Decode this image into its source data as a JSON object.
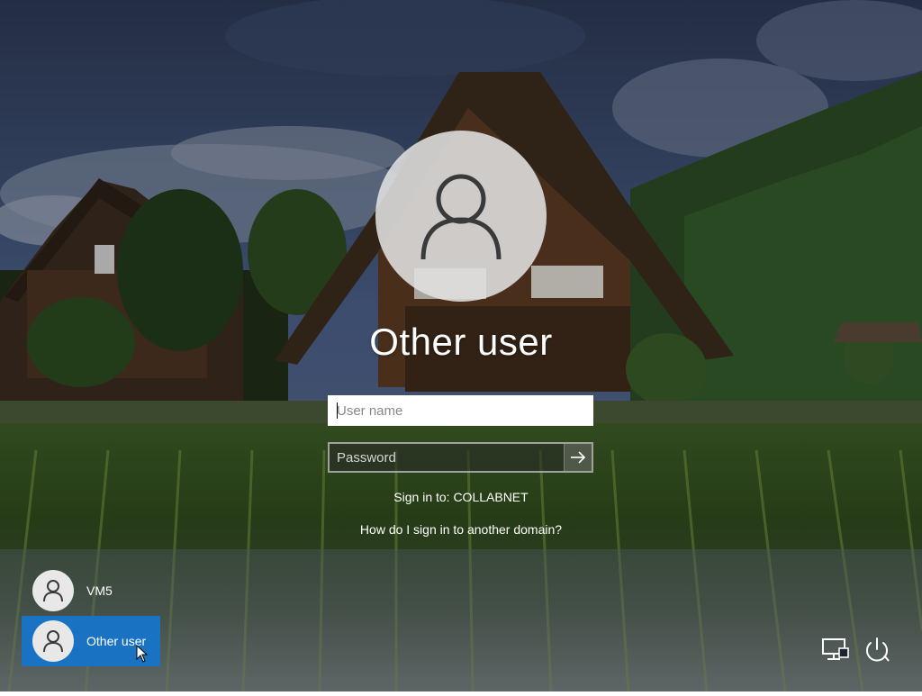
{
  "login": {
    "title": "Other user",
    "username_placeholder": "User name",
    "password_placeholder": "Password",
    "signin_to": "Sign in to: COLLABNET",
    "help_link": "How do I sign in to another domain?"
  },
  "users": [
    {
      "name": "VM5",
      "selected": false
    },
    {
      "name": "Other user",
      "selected": true
    }
  ],
  "icons": {
    "avatar": "user-avatar-icon",
    "submit": "arrow-right-icon",
    "network": "network-icon",
    "power": "power-icon"
  },
  "colors": {
    "selected_tile": "#1a73c2",
    "avatar_circle": "#e1e1e1"
  }
}
